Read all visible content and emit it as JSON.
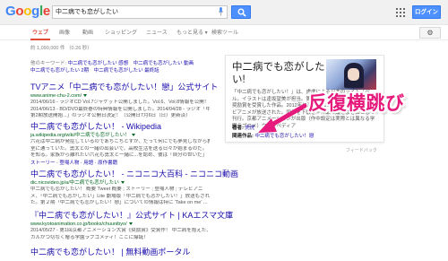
{
  "header": {
    "logo_letters": [
      "G",
      "o",
      "o",
      "g",
      "l",
      "e"
    ],
    "search_query": "中二病でも恋がしたい",
    "login_label": "ログイン"
  },
  "tabs": [
    "ウェブ",
    "画像",
    "動画",
    "ショッピング",
    "ニュース",
    "もっと見る ▾",
    "検索ツール"
  ],
  "active_tab": "ウェブ",
  "stats": "約 1,090,000 件 （0.26 秒）",
  "related_searches": {
    "label": "他のキーワード:",
    "line1": [
      "中二病でも恋がしたい 感想",
      "中二病でも恋がしたい 動画"
    ],
    "line2": [
      "中二病でも恋がしたい 2期",
      "中二病でも恋がしたい 最終話"
    ]
  },
  "results": [
    {
      "title": "TVアニメ「中二病でも恋がしたい！戀」公式サイト",
      "url": "www.anime-chu-2.com/",
      "snippet": [
        "2014/06/16 - ラジオCD Vol.7ジャケット公開しました。Vol.6、Vol.8情報を公開！",
        "2014/06/13 - BD/DVD最終巻の特典情報を公開しました。2014/04/28 - ラジオ「中二病でも恋",
        "がしたい！～",
        "第2期放送開始...」のラジオ公開日決定！（公開日7月6日（日）更新済）"
      ],
      "links": ""
    },
    {
      "title": "中二病でも恋がしたい！ - Wikipedia",
      "url": "ja.wikipedia.org/wiki/中二病でも恋がしたい！",
      "snippet": [
        "六花は中二病が発症しているのであちこちとすが、だって何にでも夢見しながら教",
        "室に通っていた。勇太との一緒の出会いで、高校生活を送る日々が始まるのだ。",
        "を知る。家族から離れたい六花も勇太と一緒に...を認め、彼は「自分の世いだ」",
        "という..."
      ],
      "links": "ストーリー · 登場人物 · 用語 · 原作書籍"
    },
    {
      "title": "中二病でも恋がしたい！ - ニコニコ大百科 - ニコニコ動画",
      "url": "dic.nicovideo.jp/a/中二病でも恋がしたい",
      "snippet": [
        "中二病でも恋がしたい！ 概要 Tweet 概要 ; ストーリー ; 登場人物 ; テレビアニ",
        "メ、「中二病でも恋がしたい」Lite 劇場版「中二病でも恋がしたい！」放送もされ",
        "た。第２期「中二病でも恋がしたい！戀」についての情報は特に 'Take on me' ..."
      ],
      "links": ""
    },
    {
      "title": "『中二病でも恋がしたい！』公式サイト | KAエスマ文庫",
      "url": "www.kyotoanimation.co.jp/books/chuunibyo/",
      "snippet": [
        "2014/05/27 - 第1回京都アニメーション大賞《奨励賞》受賞作！ 中二病を抱えた、コミ",
        "カルかつ切なく贈る学園ラブコメディ！ここに爆誕！"
      ],
      "links": ""
    },
    {
      "title": "中二病でも恋がしたい！ | 無料動画ポータル",
      "url": "",
      "snippet": [],
      "links": ""
    }
  ],
  "knowledge_panel": {
    "title": "中二病でも恋がした い!",
    "description": "「中二病でも恋がしたい！」は、虎虎による日本のライトノベル。イラストは逢坂望美が担当。第1回京都アニメーション大賞奨励賞を受賞した作品。2012年に京都アニメーション制作のテレビアニメが放送された。同作を下敷き・作品の絵をまさにとして刊行。京都アニメーションが出版（作中設定は実際とは異なる学園ラブコメ）ウィキペディア",
    "author_label": "著者:",
    "author_value": "虎虎",
    "related_label": "関連作品:",
    "related_value": "中二病でも恋がしたい！戀",
    "feedback": "フィードバック"
  },
  "overlay": {
    "text": "反復横跳び",
    "color": "#e6197c"
  }
}
